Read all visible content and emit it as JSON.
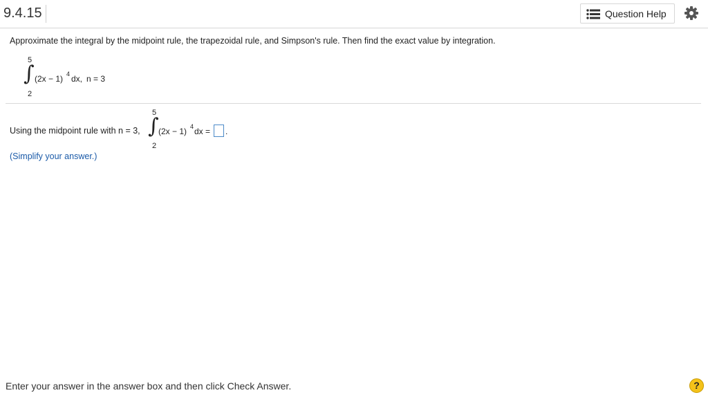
{
  "header": {
    "question_number": "9.4.15",
    "help_label": "Question Help",
    "help_icon": "list-icon",
    "settings_icon": "gear-icon"
  },
  "problem": {
    "instructions": "Approximate the integral by the midpoint rule, the trapezoidal rule, and Simpson's rule. Then find the exact value by integration.",
    "integral": {
      "upper": "5",
      "lower": "2",
      "integrand": "(2x − 1)",
      "exponent": "4",
      "differential": "dx,",
      "n_text": "n = 3"
    }
  },
  "part": {
    "prompt": "Using the midpoint rule with n = 3,",
    "integral": {
      "upper": "5",
      "lower": "2",
      "integrand": "(2x − 1)",
      "exponent": "4",
      "differential": "dx ="
    },
    "answer_value": "",
    "period": ".",
    "hint": "(Simplify your answer.)"
  },
  "footer": {
    "instruction": "Enter your answer in the answer box and then click Check Answer.",
    "help_symbol": "?"
  },
  "colors": {
    "link_blue": "#1a5aa8",
    "answer_box_border": "#4a89c8",
    "help_badge": "#f4c21a"
  }
}
